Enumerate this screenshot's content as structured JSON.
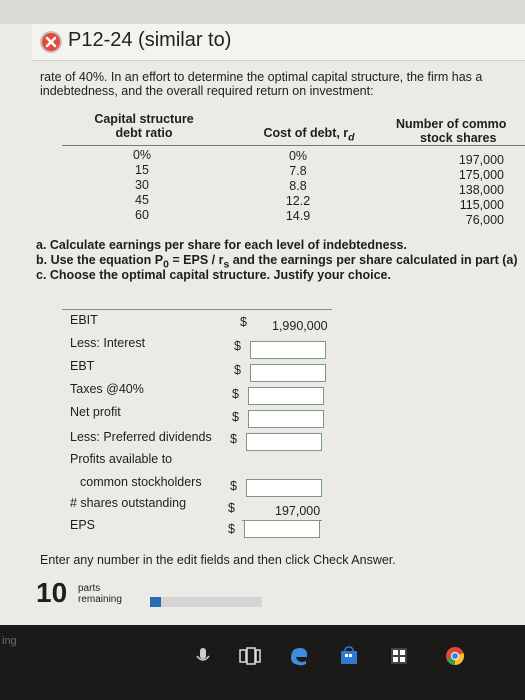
{
  "header": {
    "title": "P12-24 (similar to)"
  },
  "intro": [
    "rate of 40%. In an effort to determine the optimal capital structure, the firm has a",
    "indebtedness, and the overall required return on investment:"
  ],
  "table": {
    "headers": {
      "structure_line1": "Capital structure",
      "structure_line2": "debt ratio",
      "cost_line1": "Cost of debt, r",
      "cost_sub": "d",
      "shares_line1": "Number of commo",
      "shares_line2": "stock shares"
    },
    "debt_ratios": [
      "0%",
      "15",
      "30",
      "45",
      "60"
    ],
    "cost_of_debt": [
      "0%",
      "7.8",
      "8.8",
      "12.2",
      "14.9"
    ],
    "shares": [
      "197,000",
      "175,000",
      "138,000",
      "115,000",
      "76,000"
    ]
  },
  "parts": {
    "a": "a. Calculate earnings per share for each level of indebtedness.",
    "b_pre": "b. Use the equation P",
    "b_sub0": "0",
    "b_mid": " = EPS / r",
    "b_subs": "s",
    "b_post": " and the earnings per share calculated in part (a)",
    "c": "c. Choose the optimal capital structure. Justify your choice."
  },
  "worksheet": {
    "ebit_label": "EBIT",
    "ebit_value": "1,990,000",
    "interest_label": "Less: Interest",
    "ebt_label": "EBT",
    "taxes_label": "Taxes @40%",
    "net_profit_label": "Net profit",
    "preferred_label": "Less: Preferred dividends",
    "profits_label_1": "Profits available to",
    "profits_label_2": "common stockholders",
    "shares_label": "# shares outstanding",
    "shares_value": "197,000",
    "eps_label": "EPS",
    "currency": "$"
  },
  "footer": {
    "instruction": "Enter any number in the edit fields and then click Check Answer.",
    "parts_count": "10",
    "parts_word": "parts",
    "remaining_word": "remaining",
    "progress_fraction": 0.1
  },
  "taskbar": {
    "left_text": "ing",
    "icons": [
      "microphone-icon",
      "task-view-icon",
      "edge-icon",
      "store-icon",
      "calculator-icon",
      "chrome-icon"
    ]
  },
  "colors": {
    "error": "#e14a3c",
    "progress": "#2b6ab5",
    "field_border": "#7a9a79"
  }
}
